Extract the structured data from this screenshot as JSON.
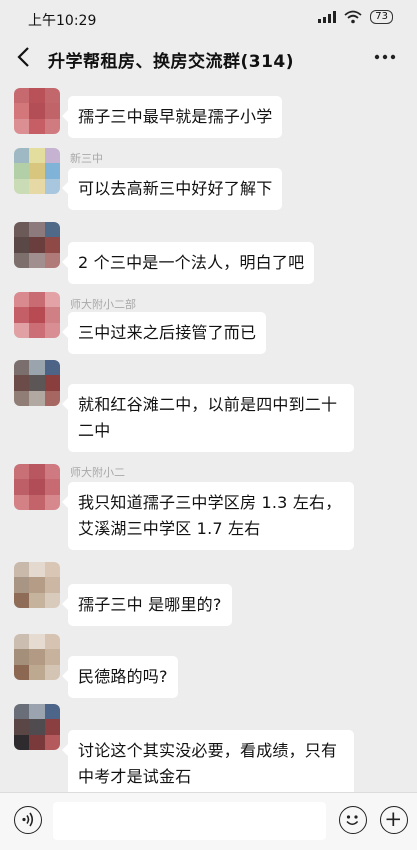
{
  "status_bar": {
    "time": "上午10:29",
    "battery": "73"
  },
  "header": {
    "title": "升学帮租房、换房交流群(314)"
  },
  "messages": [
    {
      "sender": "",
      "text": "孺子三中最早就是孺子小学"
    },
    {
      "sender": "新三中",
      "text": "可以去高新三中好好了解下"
    },
    {
      "sender": "",
      "text": "2 个三中是一个法人，明白了吧"
    },
    {
      "sender": "师大附小二部",
      "text": "三中过来之后接管了而已"
    },
    {
      "sender": "",
      "text": "就和红谷滩二中，以前是四中到二十二中"
    },
    {
      "sender": "师大附小二",
      "text": "我只知道孺子三中学区房 1.3 左右，艾溪湖三中学区 1.7 左右"
    },
    {
      "sender": "",
      "text": "孺子三中 是哪里的?"
    },
    {
      "sender": "",
      "text": "民德路的吗?"
    },
    {
      "sender": "",
      "text": "讨论这个其实没必要，看成绩，只有中考才是试金石"
    }
  ],
  "icons": {
    "back": "chevron-left-icon",
    "more": "more-dots-icon",
    "voice": "voice-icon",
    "emoji": "emoji-icon",
    "plus": "plus-icon"
  },
  "colors": {
    "background": "#ededed",
    "bubble": "#ffffff",
    "input_bar": "#f7f7f7"
  }
}
